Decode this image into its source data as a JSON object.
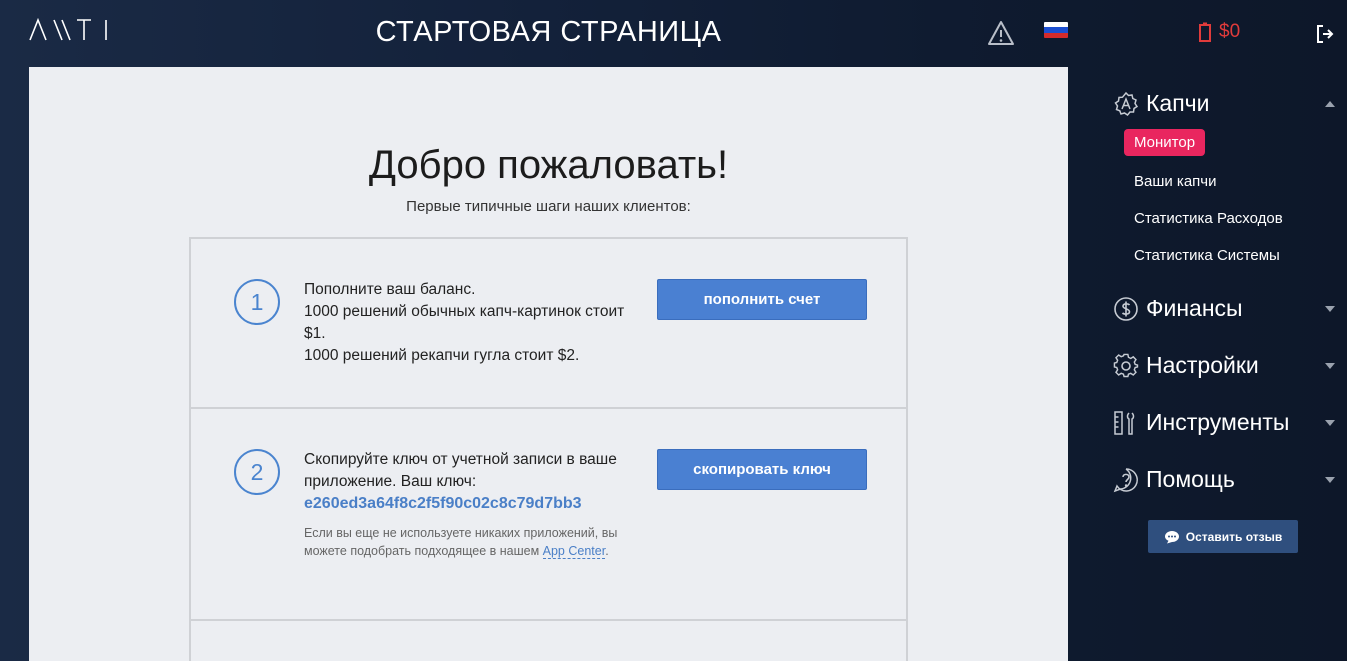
{
  "header": {
    "logo": "ΛΝΤΙ",
    "title": "СТАРТОВАЯ СТРАНИЦА",
    "balance": "$0",
    "flag_colors": [
      "#ffffff",
      "#1c4fd1",
      "#d42b2b"
    ]
  },
  "main": {
    "welcome": "Добро пожаловать!",
    "subtitle": "Первые типичные шаги наших клиентов:",
    "steps": [
      {
        "number": "1",
        "lines": [
          "Пополните ваш баланс.",
          "1000 решений обычных капч-картинок стоит $1.",
          "1000 решений рекапчи гугла стоит $2."
        ],
        "button": "пополнить счет"
      },
      {
        "number": "2",
        "text": "Скопируйте ключ от учетной записи в ваше приложение. Ваш ключ:",
        "key": "e260ed3a64f8c2f5f90c02c8c79d7bb3",
        "hint_prefix": "Если вы еще не используете никаких приложений, вы можете подобрать подходящее в нашем",
        "hint_link": "App Center",
        "hint_suffix": ".",
        "button": "скопировать ключ"
      }
    ]
  },
  "sidebar": {
    "captcha": {
      "label": "Капчи",
      "items": [
        "Монитор",
        "Ваши капчи",
        "Статистика Расходов",
        "Статистика Системы"
      ]
    },
    "finance": "Финансы",
    "settings": "Настройки",
    "tools": "Инструменты",
    "help": "Помощь",
    "feedback": "Оставить отзыв"
  },
  "colors": {
    "accent": "#4a80d2",
    "active": "#e9265f",
    "balance": "#e03b3b"
  },
  "icons": [
    "warning-icon",
    "flag-ru-icon",
    "battery-icon",
    "logout-icon",
    "captcha-icon",
    "dollar-icon",
    "gear-icon",
    "tools-icon",
    "question-icon",
    "chat-icon"
  ]
}
